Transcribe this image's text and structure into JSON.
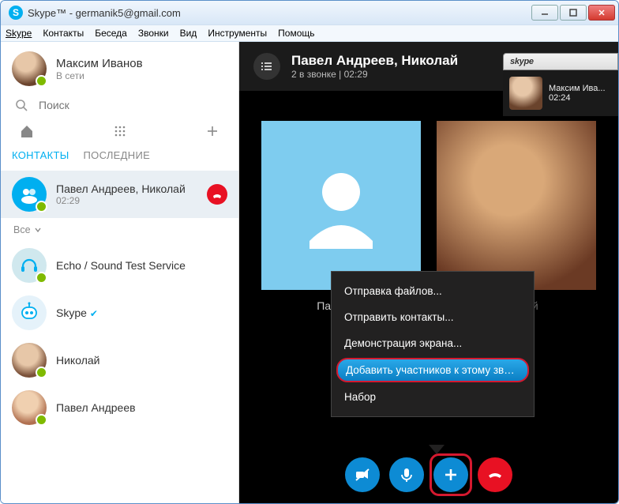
{
  "window": {
    "title": "Skype™ - germanik5@gmail.com"
  },
  "menubar": [
    "Skype",
    "Контакты",
    "Беседа",
    "Звонки",
    "Вид",
    "Инструменты",
    "Помощь"
  ],
  "profile": {
    "name": "Максим Иванов",
    "status": "В сети"
  },
  "search": {
    "placeholder": "Поиск"
  },
  "tabs": {
    "contacts": "КОНТАКТЫ",
    "recent": "ПОСЛЕДНИЕ"
  },
  "filter": "Все",
  "contacts": {
    "active": {
      "name": "Павел Андреев, Николай",
      "time": "02:29"
    },
    "items": [
      {
        "name": "Echo / Sound Test Service"
      },
      {
        "name": "Skype"
      },
      {
        "name": "Николай"
      },
      {
        "name": "Павел Андреев"
      }
    ]
  },
  "call": {
    "title": "Павел Андреев, Николай",
    "subtitle": "2 в звонке | 02:29",
    "tile1": "Павел Ан",
    "tile2": "Николай"
  },
  "contextMenu": [
    "Отправка файлов...",
    "Отправить контакты...",
    "Демонстрация экрана...",
    "Добавить участников к этому звонку...",
    "Набор"
  ],
  "pip": {
    "brand": "skype",
    "name": "Максим Ива...",
    "time": "02:24"
  }
}
